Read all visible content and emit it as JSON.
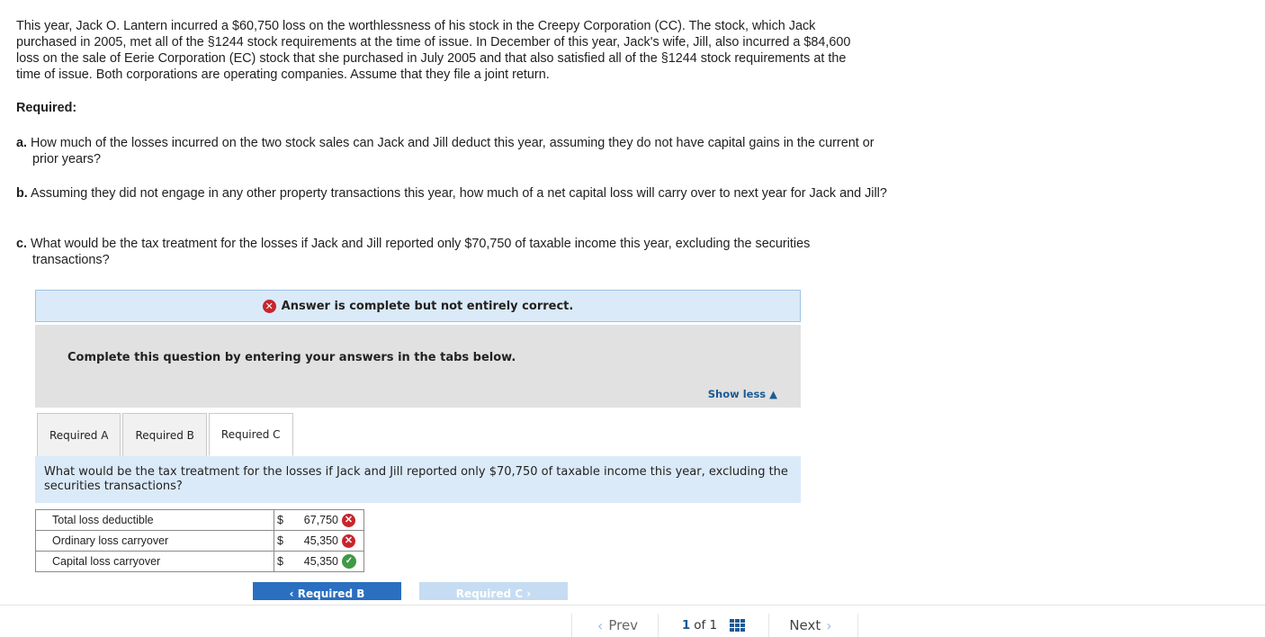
{
  "problem": {
    "intro": "This year, Jack O. Lantern incurred a $60,750 loss on the worthlessness of his stock in the Creepy Corporation (CC). The stock, which Jack purchased in 2005, met all of the §1244 stock requirements at the time of issue. In December of this year, Jack's wife, Jill, also incurred a $84,600 loss on the sale of Eerie Corporation (EC) stock that she purchased in July 2005 and that also satisfied all of the §1244 stock requirements at the time of issue. Both corporations are operating companies. Assume that they file a joint return.",
    "required_heading": "Required:",
    "items": [
      {
        "letter": "a.",
        "text": "How much of the losses incurred on the two stock sales can Jack and Jill deduct this year, assuming they do not have capital gains in the current or prior years?"
      },
      {
        "letter": "b.",
        "text": "Assuming they did not engage in any other property transactions this year, how much of a net capital loss will carry over to next year for Jack and Jill?"
      },
      {
        "letter": "c.",
        "text": "What would be the tax treatment for the losses if Jack and Jill reported only $70,750 of taxable income this year, excluding the securities transactions?"
      }
    ]
  },
  "status": {
    "icon": "x-circle-icon",
    "icon_glyph": "✕",
    "text": "Answer is complete but not entirely correct.",
    "color": "#c8252c"
  },
  "instructions": {
    "text": "Complete this question by entering your answers in the tabs below.",
    "show_less": "Show less ▲"
  },
  "tabs": [
    {
      "label": "Required A",
      "active": false
    },
    {
      "label": "Required B",
      "active": false
    },
    {
      "label": "Required C",
      "active": true
    }
  ],
  "question": "What would be the tax treatment for the losses if Jack and Jill reported only $70,750 of taxable income this year, excluding the securities transactions?",
  "answers": [
    {
      "label": "Total loss deductible",
      "currency": "$",
      "value": "67,750",
      "status": "incorrect",
      "glyph": "✕"
    },
    {
      "label": "Ordinary loss carryover",
      "currency": "$",
      "value": "45,350",
      "status": "incorrect",
      "glyph": "✕"
    },
    {
      "label": "Capital loss carryover",
      "currency": "$",
      "value": "45,350",
      "status": "correct",
      "glyph": "✓"
    }
  ],
  "nav": {
    "prev_label": "‹  Required B",
    "next_label": "Required C  ›"
  },
  "pager": {
    "prev": "Prev",
    "current": "1",
    "of_text": "of 1",
    "next": "Next",
    "chev_left": "‹",
    "chev_right": "›"
  }
}
